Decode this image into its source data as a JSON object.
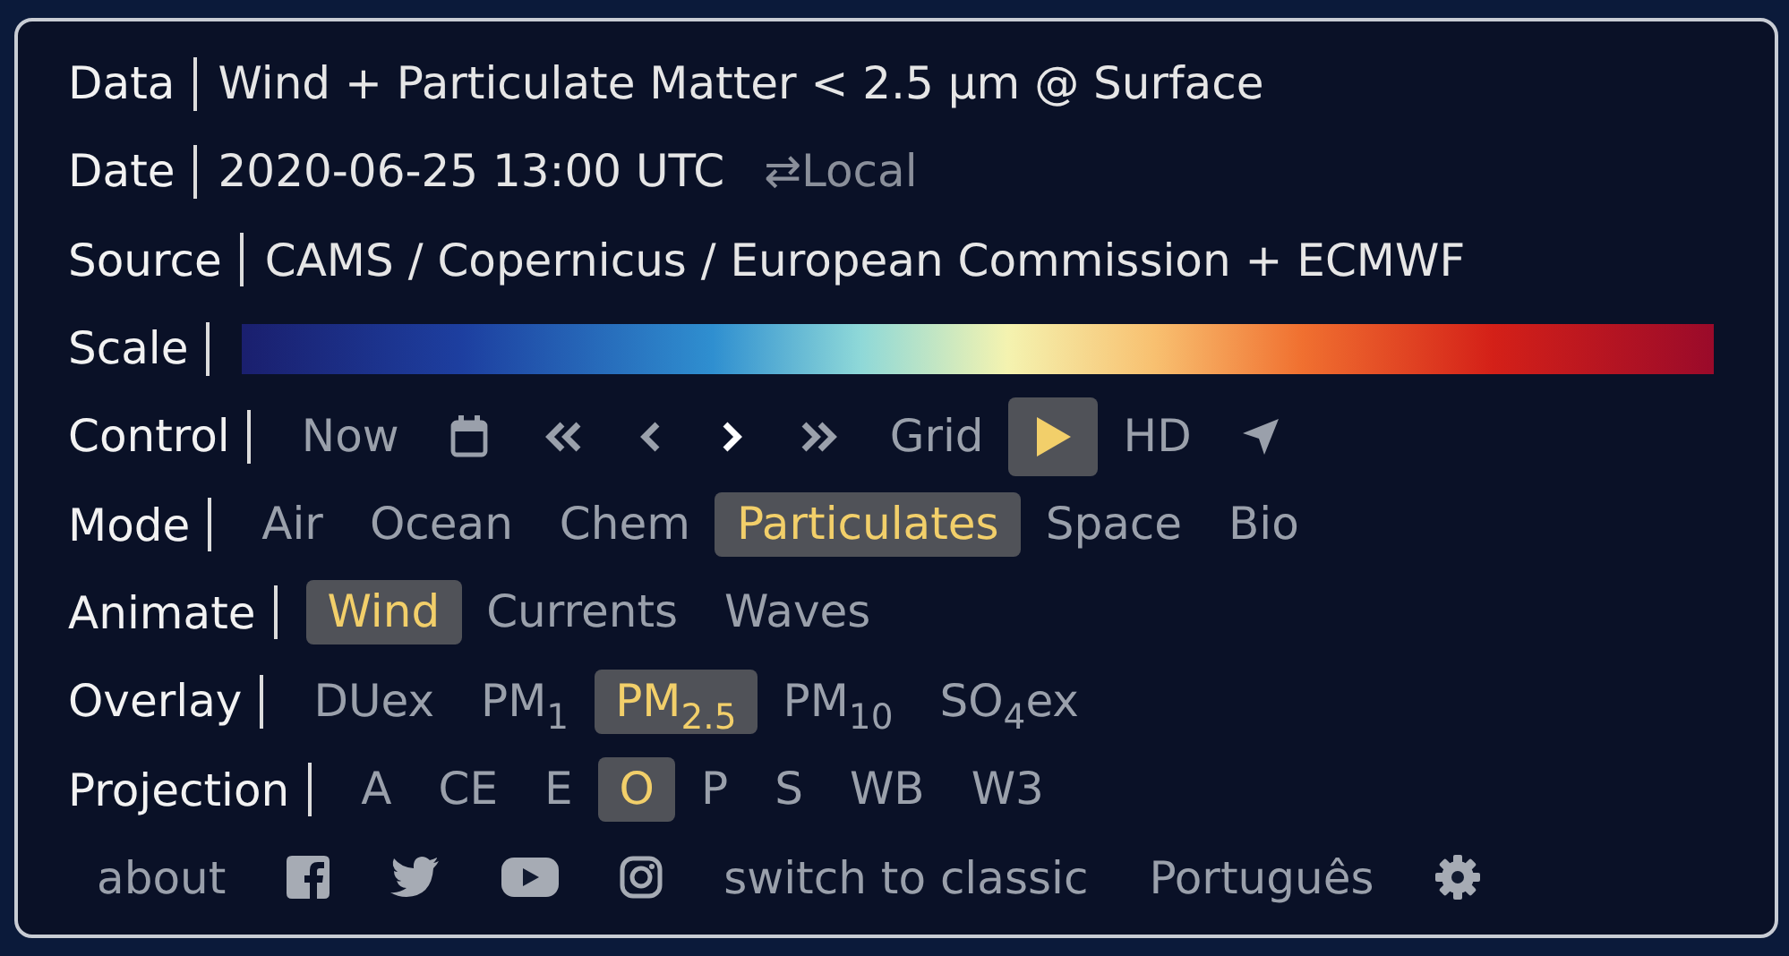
{
  "rows": [
    {
      "label": "Data",
      "kind": "text",
      "text": "Wind + Particulate Matter < 2.5 µm @ Surface"
    },
    {
      "label": "Date",
      "kind": "date",
      "text": "2020-06-25 13:00 UTC",
      "toggle": "⇄Local"
    },
    {
      "label": "Source",
      "kind": "text",
      "text": "CAMS / Copernicus / European Commission + ECMWF"
    },
    {
      "label": "Scale",
      "kind": "scale"
    },
    {
      "label": "Control",
      "kind": "buttons",
      "items": [
        {
          "kind": "text",
          "label": "Now",
          "selected": false
        },
        {
          "kind": "calendar",
          "selected": false
        },
        {
          "kind": "double-left",
          "selected": false
        },
        {
          "kind": "left",
          "selected": false
        },
        {
          "kind": "right",
          "selected": false
        },
        {
          "kind": "double-right",
          "selected": false
        },
        {
          "kind": "text",
          "label": "Grid",
          "selected": false
        },
        {
          "kind": "play",
          "selected": true
        },
        {
          "kind": "text",
          "label": "HD",
          "selected": false
        },
        {
          "kind": "locate",
          "selected": false
        }
      ]
    },
    {
      "label": "Mode",
      "kind": "buttons",
      "items": [
        {
          "kind": "text",
          "label": "Air",
          "selected": false
        },
        {
          "kind": "text",
          "label": "Ocean",
          "selected": false
        },
        {
          "kind": "text",
          "label": "Chem",
          "selected": false
        },
        {
          "kind": "text",
          "label": "Particulates",
          "selected": true
        },
        {
          "kind": "text",
          "label": "Space",
          "selected": false
        },
        {
          "kind": "text",
          "label": "Bio",
          "selected": false
        }
      ]
    },
    {
      "label": "Animate",
      "kind": "buttons",
      "items": [
        {
          "kind": "text",
          "label": "Wind",
          "selected": true
        },
        {
          "kind": "text",
          "label": "Currents",
          "selected": false
        },
        {
          "kind": "text",
          "label": "Waves",
          "selected": false
        }
      ]
    },
    {
      "label": "Overlay",
      "kind": "buttons",
      "items": [
        {
          "kind": "text",
          "label": "DUex",
          "selected": false
        },
        {
          "kind": "text",
          "label": "PM$_{1}$",
          "selected": false
        },
        {
          "kind": "text",
          "label": "PM$_{2.5}$",
          "selected": true
        },
        {
          "kind": "text",
          "label": "PM$_{10}$",
          "selected": false
        },
        {
          "kind": "text",
          "label": "SO$_{4}$ex",
          "selected": false
        }
      ]
    },
    {
      "label": "Projection",
      "kind": "buttons",
      "items": [
        {
          "kind": "text",
          "label": "A",
          "selected": false
        },
        {
          "kind": "text",
          "label": "CE",
          "selected": false
        },
        {
          "kind": "text",
          "label": "E",
          "selected": false
        },
        {
          "kind": "text",
          "label": "O",
          "selected": true
        },
        {
          "kind": "text",
          "label": "P",
          "selected": false
        },
        {
          "kind": "text",
          "label": "S",
          "selected": false
        },
        {
          "kind": "text",
          "label": "WB",
          "selected": false
        },
        {
          "kind": "text",
          "label": "W3",
          "selected": false
        }
      ]
    }
  ],
  "footer": [
    {
      "kind": "link",
      "label": "about"
    },
    {
      "kind": "facebook"
    },
    {
      "kind": "twitter"
    },
    {
      "kind": "youtube"
    },
    {
      "kind": "instagram"
    },
    {
      "kind": "link",
      "label": "switch to classic"
    },
    {
      "kind": "link",
      "label": "Português"
    },
    {
      "kind": "settings"
    }
  ]
}
